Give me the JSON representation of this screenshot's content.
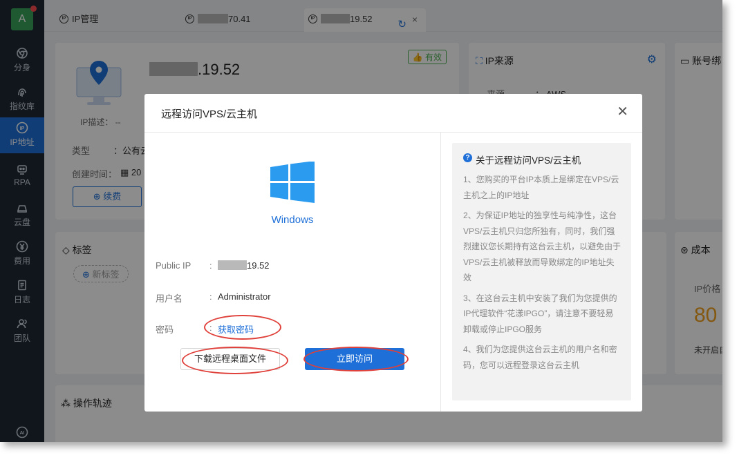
{
  "sidebar": {
    "avatar_letter": "A",
    "items": [
      {
        "label": "分身",
        "icon": "chrome-icon"
      },
      {
        "label": "指纹库",
        "icon": "fingerprint-icon"
      },
      {
        "label": "IP地址",
        "icon": "ip-icon",
        "active": true
      },
      {
        "label": "RPA",
        "icon": "robot-icon"
      },
      {
        "label": "云盘",
        "icon": "cloud-drive-icon"
      },
      {
        "label": "费用",
        "icon": "yuan-icon"
      },
      {
        "label": "日志",
        "icon": "log-icon"
      },
      {
        "label": "团队",
        "icon": "team-icon"
      }
    ],
    "ai_label": "AI"
  },
  "tabs": [
    {
      "label": "IP管理"
    },
    {
      "label": "70.41",
      "masked": true
    },
    {
      "label": "19.52",
      "masked": true,
      "active": true
    }
  ],
  "background": {
    "ip_title": ".19.52",
    "valid_badge": "有效",
    "ip_desc_label": "IP描述：",
    "ip_desc_value": "--",
    "type_label": "类型",
    "type_value": "公有云",
    "created_label": "创建时间：",
    "created_value": "20",
    "renew_button": "续费",
    "source_title": "IP来源",
    "source_label": "来源",
    "source_value": "AWS",
    "account_title": "账号绑",
    "tags_title": "标签",
    "new_tag": "新标签",
    "cost_title": "成本",
    "ip_price_label": "IP价格",
    "price_partial": "80",
    "auto_renew": "未开启自",
    "ops_title": "操作轨迹"
  },
  "modal": {
    "title": "远程访问VPS/云主机",
    "os_label": "Windows",
    "public_ip_label": "Public IP",
    "public_ip_value": "19.52",
    "username_label": "用户名",
    "username_value": "Administrator",
    "password_label": "密码",
    "password_link": "获取密码",
    "download_button": "下载远程桌面文件",
    "access_button": "立即访问",
    "info_title": "关于远程访问VPS/云主机",
    "info_points": [
      "1、您购买的平台IP本质上是绑定在VPS/云主机之上的IP地址",
      "2、为保证IP地址的独享性与纯净性，这台VPS/云主机只归您所独有，同时，我们强烈建议您长期持有这台云主机，以避免由于VPS/云主机被释放而导致绑定的IP地址失效",
      "3、在这台云主机中安装了我们为您提供的IP代理软件“花漾IPGO”，请注意不要轻易卸载或停止IPGO服务",
      "4、我们为您提供这台云主机的用户名和密码，您可以远程登录这台云主机"
    ]
  },
  "colors": {
    "primary": "#1e6fd8",
    "sidebar_bg": "#1f2733",
    "highlight_ellipse": "#e0403a",
    "valid_green": "#4caf50"
  }
}
